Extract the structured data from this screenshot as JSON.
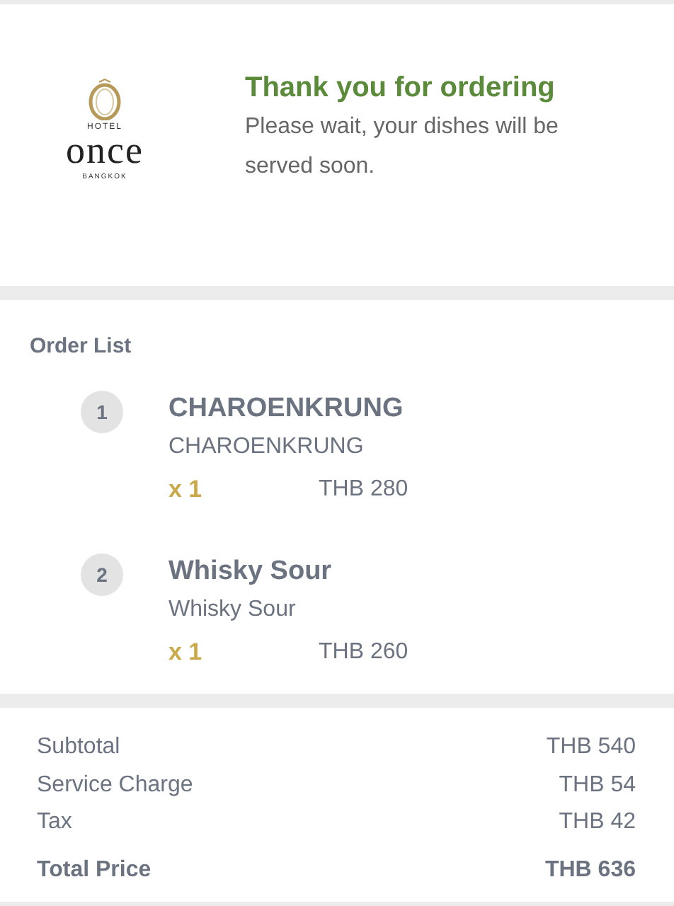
{
  "header": {
    "logo": {
      "top": "HOTEL",
      "name": "once",
      "bottom": "BANGKOK"
    },
    "title": "Thank you for ordering",
    "message": "Please wait, your dishes will be served soon."
  },
  "order_list": {
    "title": "Order List",
    "items": [
      {
        "index": "1",
        "name": "CHAROENKRUNG",
        "subtitle": "CHAROENKRUNG",
        "quantity": "x 1",
        "price": "THB 280"
      },
      {
        "index": "2",
        "name": "Whisky Sour",
        "subtitle": "Whisky Sour",
        "quantity": "x 1",
        "price": "THB 260"
      }
    ]
  },
  "summary": {
    "rows": [
      {
        "label": "Subtotal",
        "value": "THB 540",
        "kind": "normal"
      },
      {
        "label": "Service Charge",
        "value": "THB 54",
        "kind": "normal"
      },
      {
        "label": "Tax",
        "value": "THB 42",
        "kind": "normal"
      },
      {
        "label": "Total Price",
        "value": "THB 636",
        "kind": "total"
      }
    ]
  }
}
